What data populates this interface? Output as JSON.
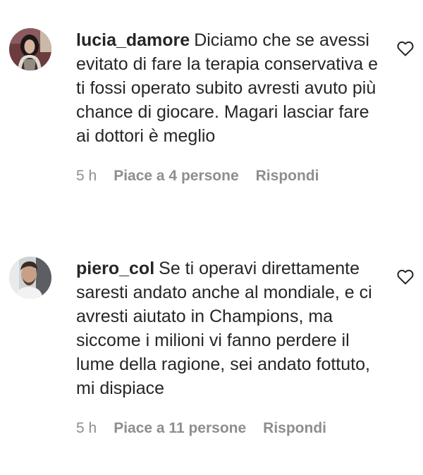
{
  "comments": [
    {
      "username": "lucia_damore",
      "text": "Diciamo che se avessi evitato di fare la terapia conservativa e ti fossi operato subito avresti avuto più chance di giocare. Magari lasciar fare ai dottori è meglio",
      "time": "5 h",
      "likes": "Piace a 4 persone",
      "reply": "Rispondi",
      "avatar_icon": "profile-photo",
      "like_icon": "heart-outline-icon"
    },
    {
      "username": "piero_col",
      "text": "Se ti operavi direttamente saresti andato anche al mondiale, e ci avresti aiutato in Champions, ma siccome i milioni vi fanno perdere il lume della ragione, sei andato fottuto, mi dispiace",
      "time": "5 h",
      "likes": "Piace a 11 persone",
      "reply": "Rispondi",
      "avatar_icon": "profile-photo",
      "like_icon": "heart-outline-icon"
    }
  ],
  "colors": {
    "text": "#262626",
    "secondary": "#8e8e8e",
    "background": "#ffffff"
  }
}
